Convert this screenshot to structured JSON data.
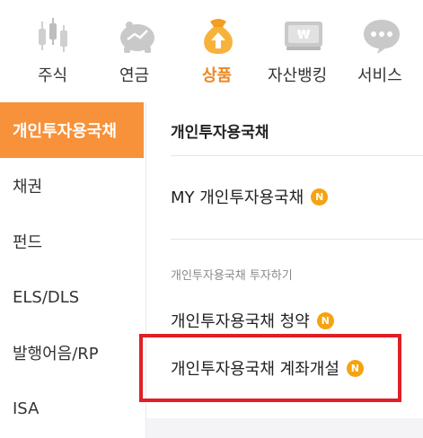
{
  "topnav": {
    "items": [
      {
        "label": "주식",
        "icon": "stock-candles-icon",
        "active": false
      },
      {
        "label": "연금",
        "icon": "piggy-bank-icon",
        "active": false
      },
      {
        "label": "상품",
        "icon": "money-bag-icon",
        "active": true
      },
      {
        "label": "자산뱅킹",
        "icon": "won-card-icon",
        "active": false
      },
      {
        "label": "서비스",
        "icon": "chat-bubble-icon",
        "active": false
      }
    ]
  },
  "sidebar": {
    "items": [
      {
        "label": "개인투자용국채",
        "active": true
      },
      {
        "label": "채권",
        "active": false
      },
      {
        "label": "펀드",
        "active": false
      },
      {
        "label": "ELS/DLS",
        "active": false
      },
      {
        "label": "발행어음/RP",
        "active": false
      },
      {
        "label": "ISA",
        "active": false
      }
    ]
  },
  "main": {
    "title": "개인투자용국채",
    "my_item": {
      "label": "MY 개인투자용국채",
      "badge": "N"
    },
    "section_caption": "개인투자용국채 투자하기",
    "subscribe_item": {
      "label": "개인투자용국채 청약",
      "badge": "N"
    },
    "account_item": {
      "label": "개인투자용국채 계좌개설",
      "badge": "N"
    }
  },
  "colors": {
    "accent": "#f7913a",
    "active_nav_text": "#f0871f",
    "badge": "#f5a30f",
    "highlight": "#e01f26"
  }
}
